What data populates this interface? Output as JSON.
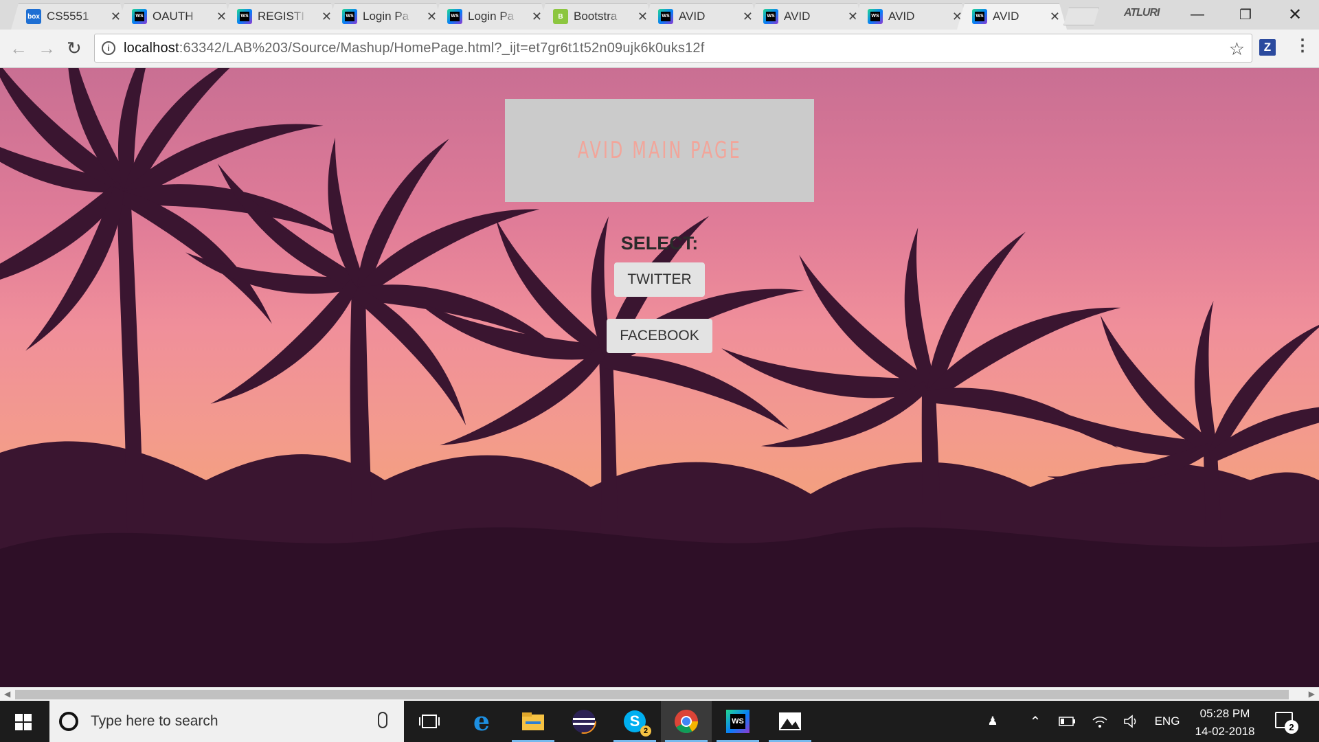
{
  "browser": {
    "tabs": [
      {
        "title": "CS5551",
        "favicon": "box-icon"
      },
      {
        "title": "OAUTH",
        "favicon": "webstorm-icon"
      },
      {
        "title": "REGISTI",
        "favicon": "webstorm-icon"
      },
      {
        "title": "Login Pa",
        "favicon": "webstorm-icon"
      },
      {
        "title": "Login Pa",
        "favicon": "webstorm-icon"
      },
      {
        "title": "Bootstra",
        "favicon": "bootstrap-icon"
      },
      {
        "title": "AVID",
        "favicon": "webstorm-icon"
      },
      {
        "title": "AVID",
        "favicon": "webstorm-icon"
      },
      {
        "title": "AVID",
        "favicon": "webstorm-icon"
      },
      {
        "title": "AVID",
        "favicon": "webstorm-icon",
        "active": true
      }
    ],
    "profile_name": "ATLURI",
    "url_host": "localhost",
    "url_path": ":63342/LAB%203/Source/Mashup/HomePage.html?_ijt=et7gr6t1t52n09ujk6k0uks12f",
    "extension_label": "Z"
  },
  "page": {
    "banner_title": "AVID MAIN PAGE",
    "select_label": "SELECT:",
    "twitter_button": "TWITTER",
    "facebook_button": "FACEBOOK",
    "background": "palm-trees-sunset-image"
  },
  "taskbar": {
    "search_placeholder": "Type here to search",
    "apps": [
      "task-view-icon",
      "edge-icon",
      "file-explorer-icon",
      "eclipse-icon",
      "skype-icon",
      "chrome-icon",
      "webstorm-icon",
      "photos-icon"
    ],
    "skype_badge": "2",
    "language": "ENG",
    "time": "05:28 PM",
    "date": "14-02-2018",
    "notification_count": "2"
  },
  "colors": {
    "accent_blue": "#76b9ed",
    "banner_bg": "#cbcbcb",
    "banner_text": "#f2a59a",
    "button_bg": "#e3e3e3"
  }
}
